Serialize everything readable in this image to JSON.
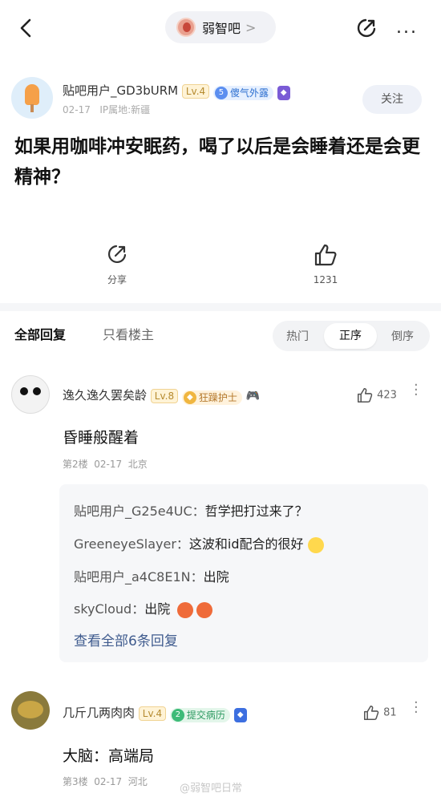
{
  "topbar": {
    "forum_name": "弱智吧",
    "chevron": ">",
    "more": "..."
  },
  "post": {
    "author": "贴吧用户_GD3bURM",
    "level": "Lv.4",
    "title_badge_num": "5",
    "title_badge_text": "傻气外露",
    "date": "02-17",
    "ip": "IP属地:新疆",
    "follow_label": "关注",
    "title": "如果用咖啡冲安眠药，喝了以后是会睡着还是会更精神？",
    "share_label": "分享",
    "like_count": "1231"
  },
  "reply_tabs": {
    "all": "全部回复",
    "owner_only": "只看楼主",
    "sort_hot": "热门",
    "sort_asc": "正序",
    "sort_desc": "倒序"
  },
  "replies": [
    {
      "user": "逸久逸久罢矣龄",
      "level": "Lv.8",
      "badge": "狂躁护士",
      "likes": "423",
      "text": "昏睡般醒着",
      "floor": "第2楼",
      "date": "02-17",
      "location": "北京",
      "subreplies": [
        {
          "user": "贴吧用户_G25e4UC：",
          "text": "哲学把打过来了？"
        },
        {
          "user": "GreeneyeSlayer：",
          "text": "这波和id配合的很好"
        },
        {
          "user": "贴吧用户_a4C8E1N：",
          "text": "出院"
        },
        {
          "user": "skyCloud：",
          "text": "出院"
        }
      ],
      "view_all": "查看全部6条回复"
    },
    {
      "user": "几斤几两肉肉",
      "level": "Lv.4",
      "badge_num": "2",
      "badge": "提交病历",
      "likes": "81",
      "text": "大脑：高端局",
      "floor": "第3楼",
      "date": "02-17",
      "location": "河北"
    }
  ],
  "watermark": "@弱智吧日常"
}
